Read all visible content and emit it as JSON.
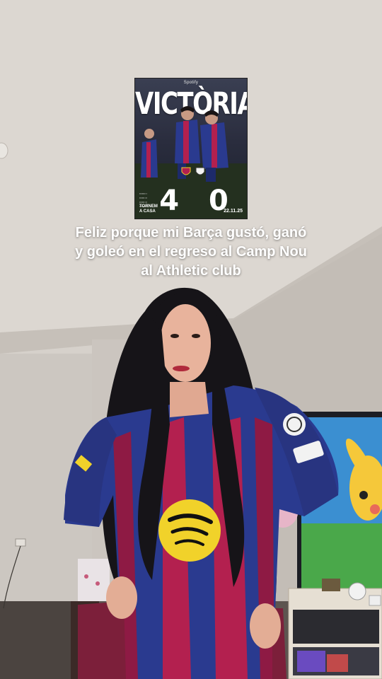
{
  "poster": {
    "sponsor": "Spotify",
    "title": "VICTÒRIA",
    "score": "4 0",
    "home_text": "TORNEM A CASA",
    "date": "22.11.25"
  },
  "caption": {
    "line1": "Feliz porque mi Barça gustó, ganó",
    "line2": "y goleó en el regreso al Camp Nou",
    "line3": "al Athletic club"
  },
  "colors": {
    "barca_blue": "#2a3a8f",
    "barca_garnet": "#b3204f",
    "wall": "#cfcac4",
    "ceiling": "#ddd8d2"
  }
}
